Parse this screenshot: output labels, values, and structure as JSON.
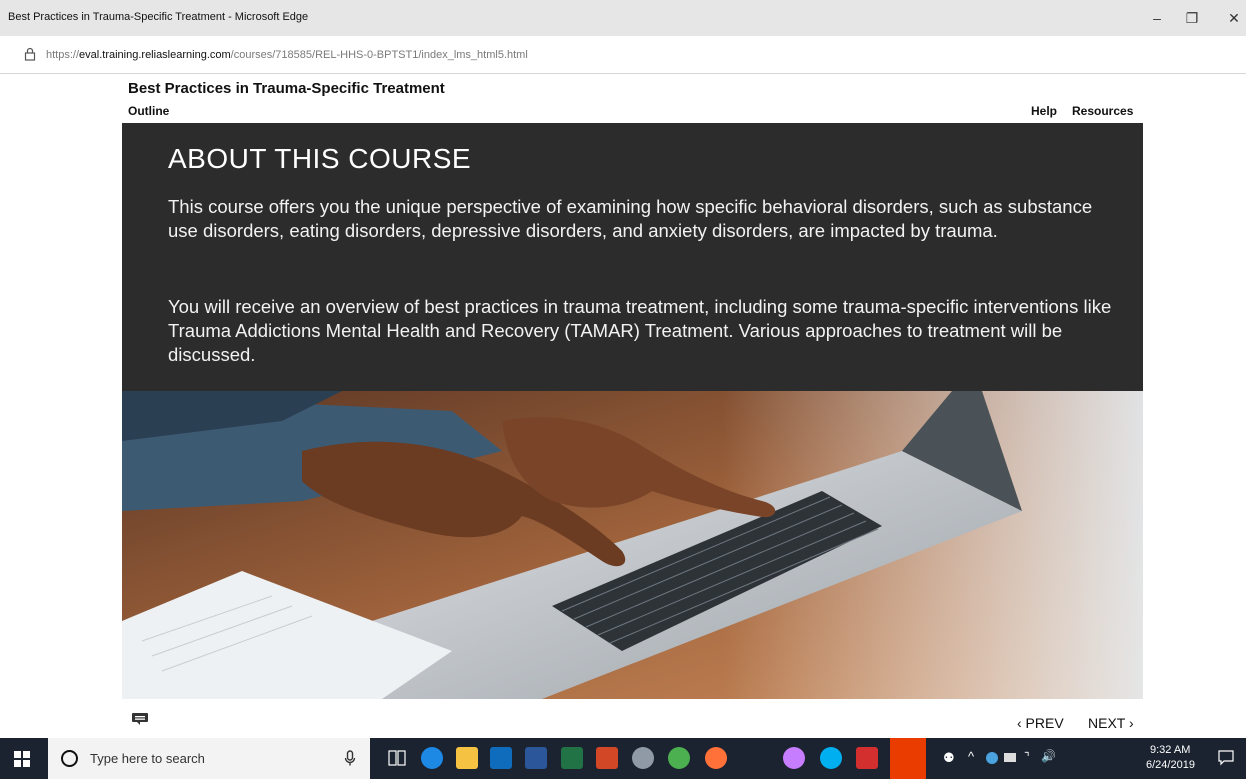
{
  "window": {
    "title": "Best Practices in Trauma-Specific Treatment - Microsoft Edge",
    "minimize_glyph": "–",
    "restore_glyph": "❐",
    "close_glyph": "✕"
  },
  "addressbar": {
    "protocol": "https://",
    "host": "eval.training.reliaslearning.com",
    "path": "/courses/718585/REL-HHS-0-BPTST1/index_lms_html5.html",
    "lock_icon": "lock-icon"
  },
  "course": {
    "title": "Best Practices in Trauma-Specific Treatment",
    "outline_label": "Outline",
    "help_label": "Help",
    "resources_label": "Resources"
  },
  "slide": {
    "heading": "ABOUT THIS COURSE",
    "paragraph1": "This course offers you the unique perspective of examining how specific behavioral disorders, such as substance use disorders, eating disorders, depressive disorders, and anxiety disorders, are impacted by trauma.",
    "paragraph2": "You will receive an overview of best practices in trauma treatment, including some trauma-specific interventions like Trauma Addictions Mental Health and Recovery (TAMAR) Treatment. Various approaches to treatment will be discussed."
  },
  "nav": {
    "prev_label": "‹ PREV",
    "next_label": "NEXT ›",
    "notes_icon": "notes-icon"
  },
  "taskbar": {
    "search_placeholder": "Type here to search",
    "time": "9:32 AM",
    "date": "6/24/2019",
    "colors": {
      "edge": "#1e88e5",
      "explorer": "#f5c242",
      "outlook": "#0f6cbd",
      "word": "#2b579a",
      "excel": "#217346",
      "powerpoint": "#d24726",
      "chrome": "#4caf50",
      "firefox": "#ff7139",
      "skype": "#00aff0",
      "acrobat": "#d32f2f",
      "office": "#eb3c00"
    }
  }
}
